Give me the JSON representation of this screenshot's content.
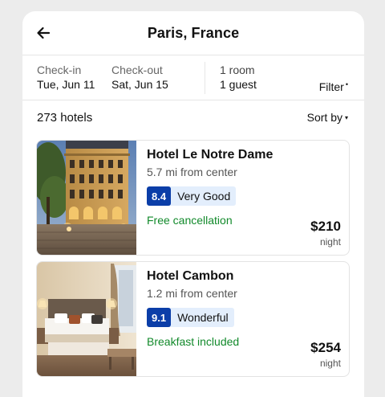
{
  "header": {
    "title": "Paris, France",
    "back_icon": "arrow-left-icon"
  },
  "summary": {
    "checkin_label": "Check-in",
    "checkin_value": "Tue, Jun 11",
    "checkout_label": "Check-out",
    "checkout_value": "Sat, Jun 15",
    "rooms": "1 room",
    "guests": "1 guest",
    "filter_label": "Filter",
    "filter_indicator": "•"
  },
  "results": {
    "count_label": "273 hotels",
    "sort_label": "Sort by",
    "sort_caret": "▾"
  },
  "hotels": [
    {
      "name": "Hotel Le Notre Dame",
      "distance": "5.7 mi from center",
      "score": "8.4",
      "rating_word": "Very Good",
      "perk": "Free cancellation",
      "price": "$210",
      "price_unit": "night",
      "image_icon": "hotel-exterior-photo"
    },
    {
      "name": "Hotel Cambon",
      "distance": "1.2 mi from center",
      "score": "9.1",
      "rating_word": "Wonderful",
      "perk": "Breakfast included",
      "price": "$254",
      "price_unit": "night",
      "image_icon": "hotel-room-photo"
    }
  ],
  "colors": {
    "rating_badge": "#0b3ea8",
    "rating_bg": "#e3eefc",
    "perk_green": "#128a2b"
  }
}
